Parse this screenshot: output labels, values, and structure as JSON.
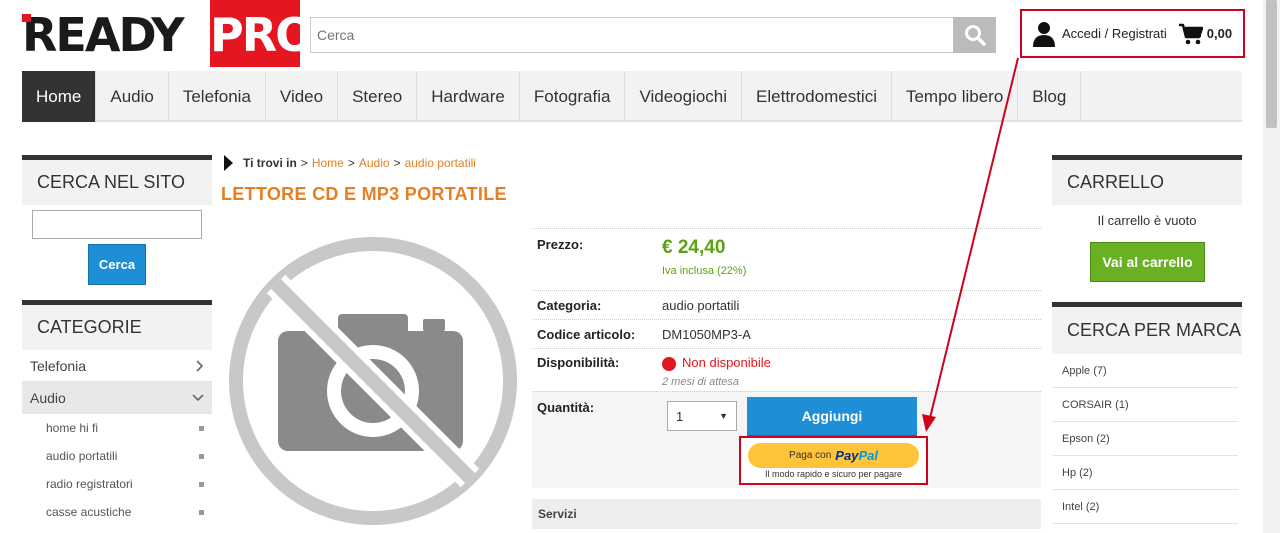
{
  "header": {
    "logo_ready": "READY",
    "logo_pro": "PRO",
    "search_placeholder": "Cerca",
    "account_label": "Accedi / Registrati",
    "cart_total": "0,00"
  },
  "nav": {
    "items": [
      "Home",
      "Audio",
      "Telefonia",
      "Video",
      "Stereo",
      "Hardware",
      "Fotografia",
      "Videogiochi",
      "Elettrodomestici",
      "Tempo libero",
      "Blog"
    ]
  },
  "left": {
    "search_title": "CERCA NEL SITO",
    "search_button": "Cerca",
    "categories_title": "CATEGORIE",
    "categories": [
      {
        "label": "Telefonia",
        "chevron": "chevron-right-icon"
      },
      {
        "label": "Audio",
        "chevron": "chevron-down-icon"
      }
    ],
    "subcategories": [
      "home hi fi",
      "audio portatili",
      "radio registratori",
      "casse acustiche"
    ]
  },
  "breadcrumb": {
    "prefix": "Ti trovi in",
    "sep": ">",
    "items": [
      "Home",
      "Audio",
      "audio portatili"
    ]
  },
  "product": {
    "title": "LETTORE CD E MP3 PORTATILE",
    "price_label": "Prezzo:",
    "price": "€ 24,40",
    "iva": "Iva inclusa (22%)",
    "category_label": "Categoria:",
    "category": "audio portatili",
    "code_label": "Codice articolo:",
    "code": "DM1050MP3-A",
    "availability_label": "Disponibilità:",
    "availability": "Non disponibile",
    "wait": "2 mesi di attesa",
    "qty_label": "Quantità:",
    "qty_value": "1",
    "add_button": "Aggiungi",
    "paypal_prefix": "Paga con",
    "paypal_brand_a": "Pay",
    "paypal_brand_b": "Pal",
    "paypal_tagline": "Il modo rapido e sicuro per pagare",
    "services_label": "Servizi"
  },
  "right": {
    "cart_title": "CARRELLO",
    "cart_empty": "Il carrello è vuoto",
    "cart_button": "Vai al carrello",
    "brand_title": "CERCA PER MARCA",
    "brands": [
      "Apple (7)",
      "CORSAIR (1)",
      "Epson (2)",
      "Hp (2)",
      "Intel (2)"
    ]
  },
  "colors": {
    "accent_orange": "#e67e22",
    "brand_red": "#e4161f",
    "button_blue": "#1e8fd6",
    "button_green": "#6ab023",
    "price_green": "#5aa313",
    "annotation_red": "#d0021b"
  }
}
